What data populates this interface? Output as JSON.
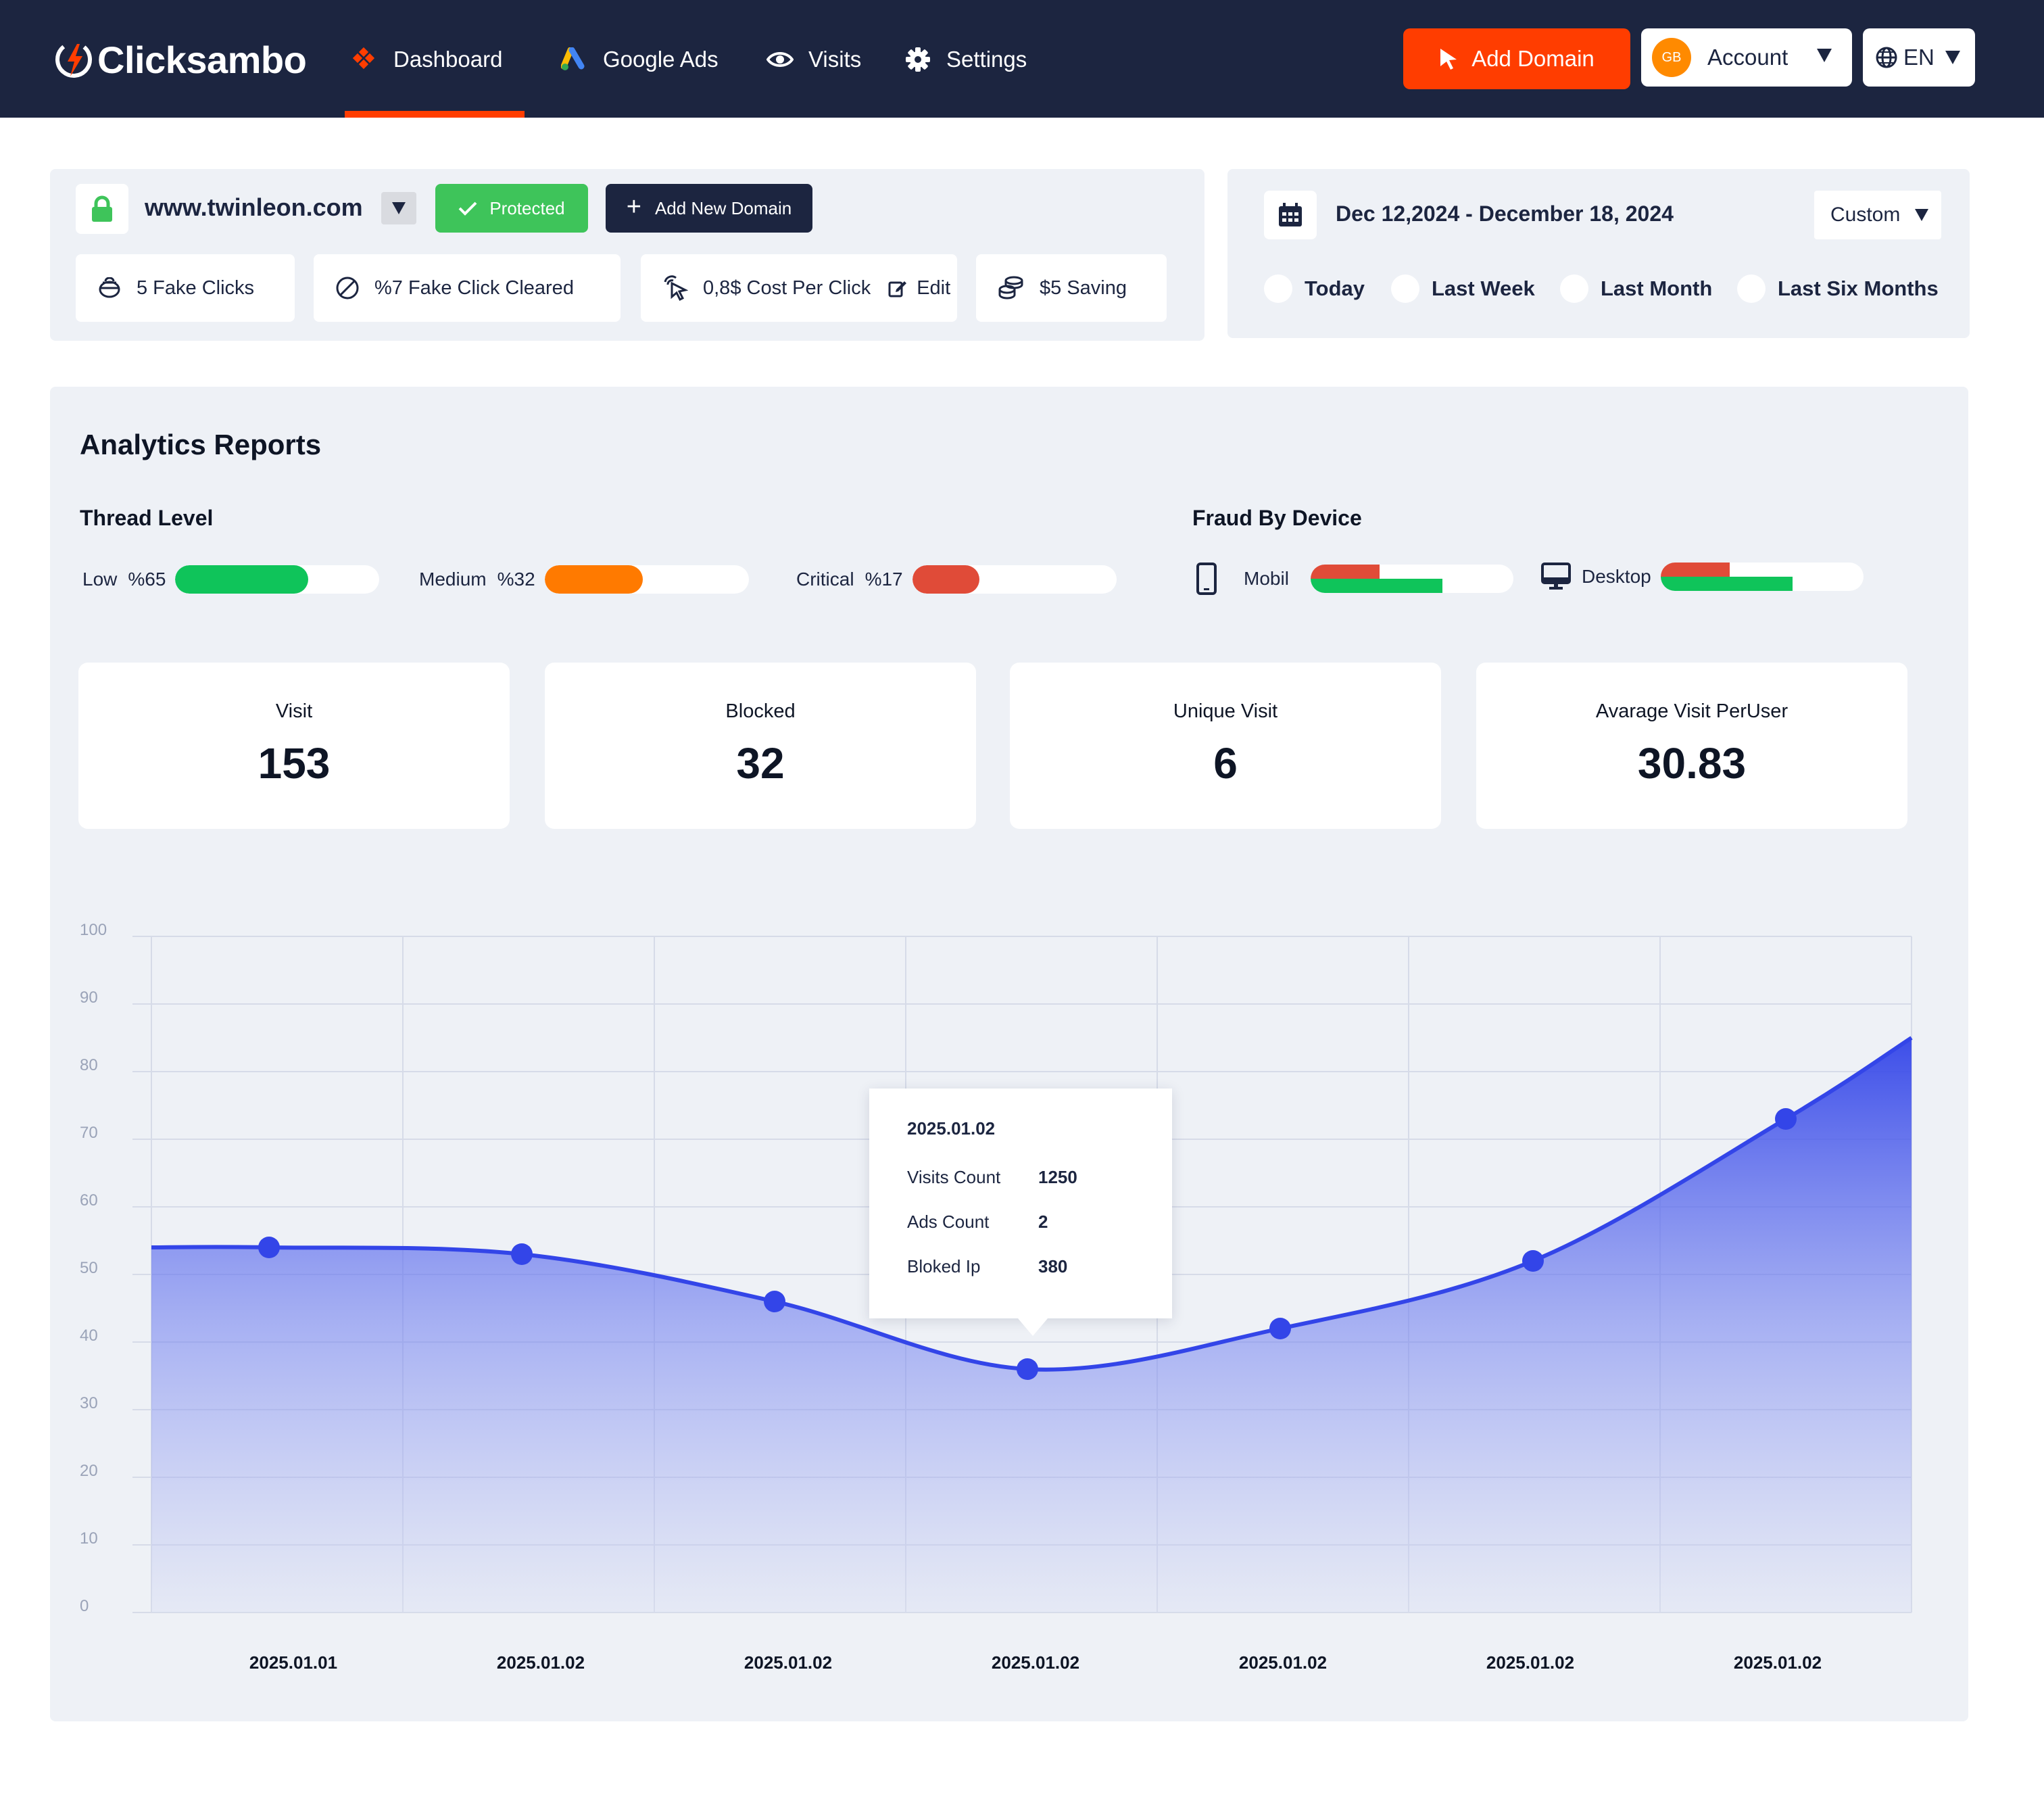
{
  "brand": {
    "name": "Clicksambo",
    "accent": "#ff3d00",
    "navy": "#1c2540"
  },
  "nav": {
    "items": [
      {
        "label": "Dashboard",
        "icon": "dashboard-diamond-icon",
        "active": true
      },
      {
        "label": "Google Ads",
        "icon": "google-ads-icon"
      },
      {
        "label": "Visits",
        "icon": "eye-icon"
      },
      {
        "label": "Settings",
        "icon": "gear-icon"
      }
    ],
    "add_domain_label": "Add Domain",
    "account": {
      "initials": "GB",
      "label": "Account"
    },
    "language": "EN"
  },
  "domain": {
    "name": "www.twinleon.com",
    "status": "Protected",
    "add_new_label": "Add New Domain",
    "stats": {
      "fake_clicks": "5 Fake Clicks",
      "fake_cleared": "%7 Fake Click Cleared",
      "cost_per_click": "0,8$ Cost Per Click",
      "edit_label": "Edit",
      "saving": "$5 Saving"
    }
  },
  "date_filter": {
    "range": "Dec 12,2024 - December 18, 2024",
    "mode": "Custom",
    "options": [
      "Today",
      "Last Week",
      "Last Month",
      "Last Six Months"
    ]
  },
  "analytics": {
    "title": "Analytics Reports",
    "threat_title": "Thread Level",
    "threat_levels": [
      {
        "name": "Low",
        "pct": "%65",
        "value": 0.65,
        "color": "#0fc45a"
      },
      {
        "name": "Medium",
        "pct": "%32",
        "value": 0.48,
        "color": "#ff7a00"
      },
      {
        "name": "Critical",
        "pct": "%17",
        "value": 0.33,
        "color": "#e04b38"
      }
    ],
    "device_title": "Fraud By Device",
    "devices": [
      {
        "name": "Mobil",
        "icon": "mobile-phone-icon",
        "red": 0.34,
        "green": 0.65
      },
      {
        "name": "Desktop",
        "icon": "desktop-monitor-icon",
        "red": 0.34,
        "green": 0.65
      }
    ],
    "kpis": [
      {
        "label": "Visit",
        "value": "153"
      },
      {
        "label": "Blocked",
        "value": "32"
      },
      {
        "label": "Unique Visit",
        "value": "6"
      },
      {
        "label": "Avarage Visit PerUser",
        "value": "30.83"
      }
    ]
  },
  "chart_data": {
    "type": "area",
    "ylim": [
      0,
      100
    ],
    "yticks": [
      100,
      90,
      80,
      70,
      60,
      50,
      40,
      30,
      20,
      10,
      0
    ],
    "xlabels": [
      "2025.01.01",
      "2025.01.02",
      "2025.01.02",
      "2025.01.02",
      "2025.01.02",
      "2025.01.02",
      "2025.01.02"
    ],
    "points": [
      54,
      53,
      46,
      36,
      42,
      52,
      73
    ],
    "start_value": 54,
    "end_value": 85,
    "color": "#3345e8",
    "grid": true,
    "tooltip": {
      "date": "2025.01.02",
      "rows": [
        {
          "label": "Visits Count",
          "value": "1250"
        },
        {
          "label": "Ads Count",
          "value": "2"
        },
        {
          "label": "Bloked Ip",
          "value": "380"
        }
      ]
    }
  }
}
